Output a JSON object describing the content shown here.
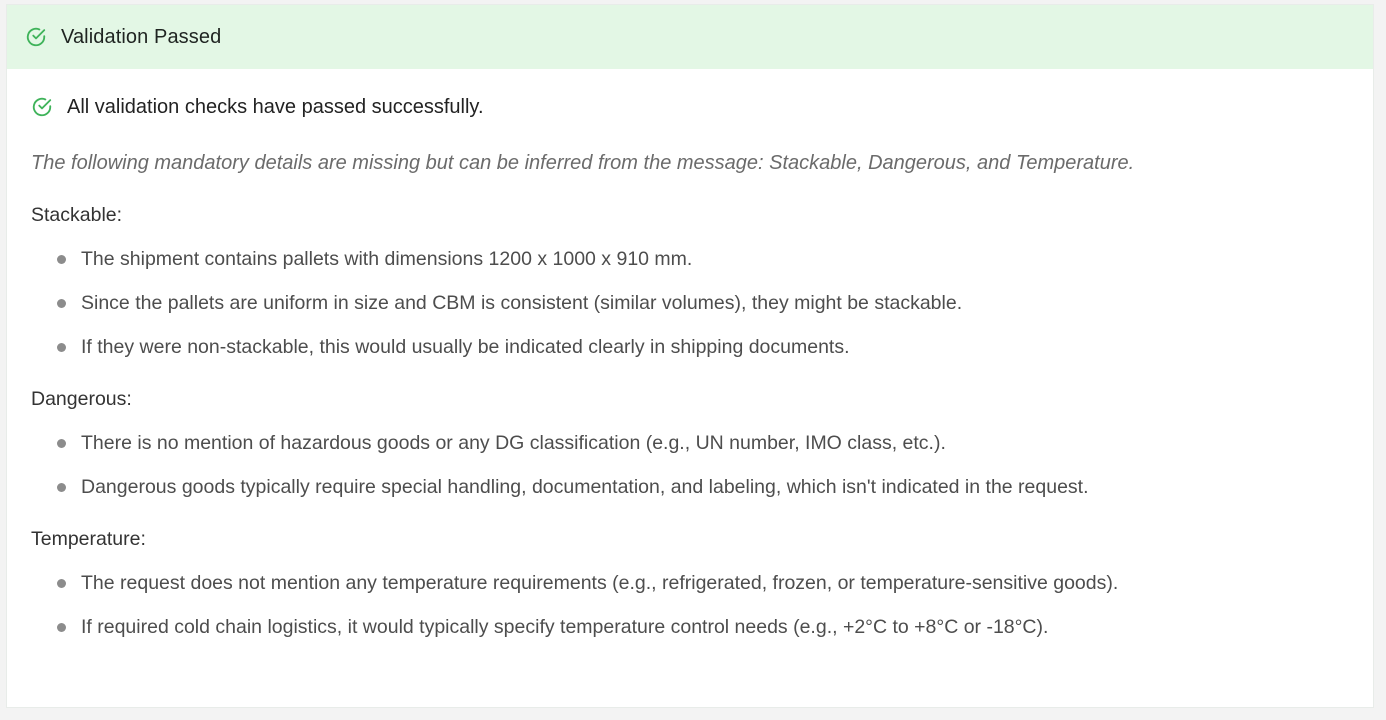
{
  "header": {
    "icon": "check-circle-icon",
    "title": "Validation Passed",
    "background": "#e3f7e5",
    "accent": "#3fb35a"
  },
  "status": {
    "icon": "check-circle-icon",
    "text": "All validation checks have passed successfully."
  },
  "intro": "The following mandatory details are missing but can be inferred from the message: Stackable, Dangerous, and Temperature.",
  "sections": [
    {
      "title": "Stackable:",
      "bullets": [
        "The shipment contains pallets with dimensions 1200 x 1000 x 910 mm.",
        "Since the pallets are uniform in size and CBM is consistent (similar volumes), they might be stackable.",
        "If they were non-stackable, this would usually be indicated clearly in shipping documents."
      ]
    },
    {
      "title": "Dangerous:",
      "bullets": [
        "There is no mention of hazardous goods or any DG classification (e.g., UN number, IMO class, etc.).",
        "Dangerous goods typically require special handling, documentation, and labeling, which isn't indicated in the request."
      ]
    },
    {
      "title": "Temperature:",
      "bullets": [
        "The request does not mention any temperature requirements (e.g., refrigerated, frozen, or temperature-sensitive goods).",
        "If required cold chain logistics, it would typically specify temperature control needs (e.g., +2°C to +8°C or -18°C)."
      ]
    }
  ]
}
